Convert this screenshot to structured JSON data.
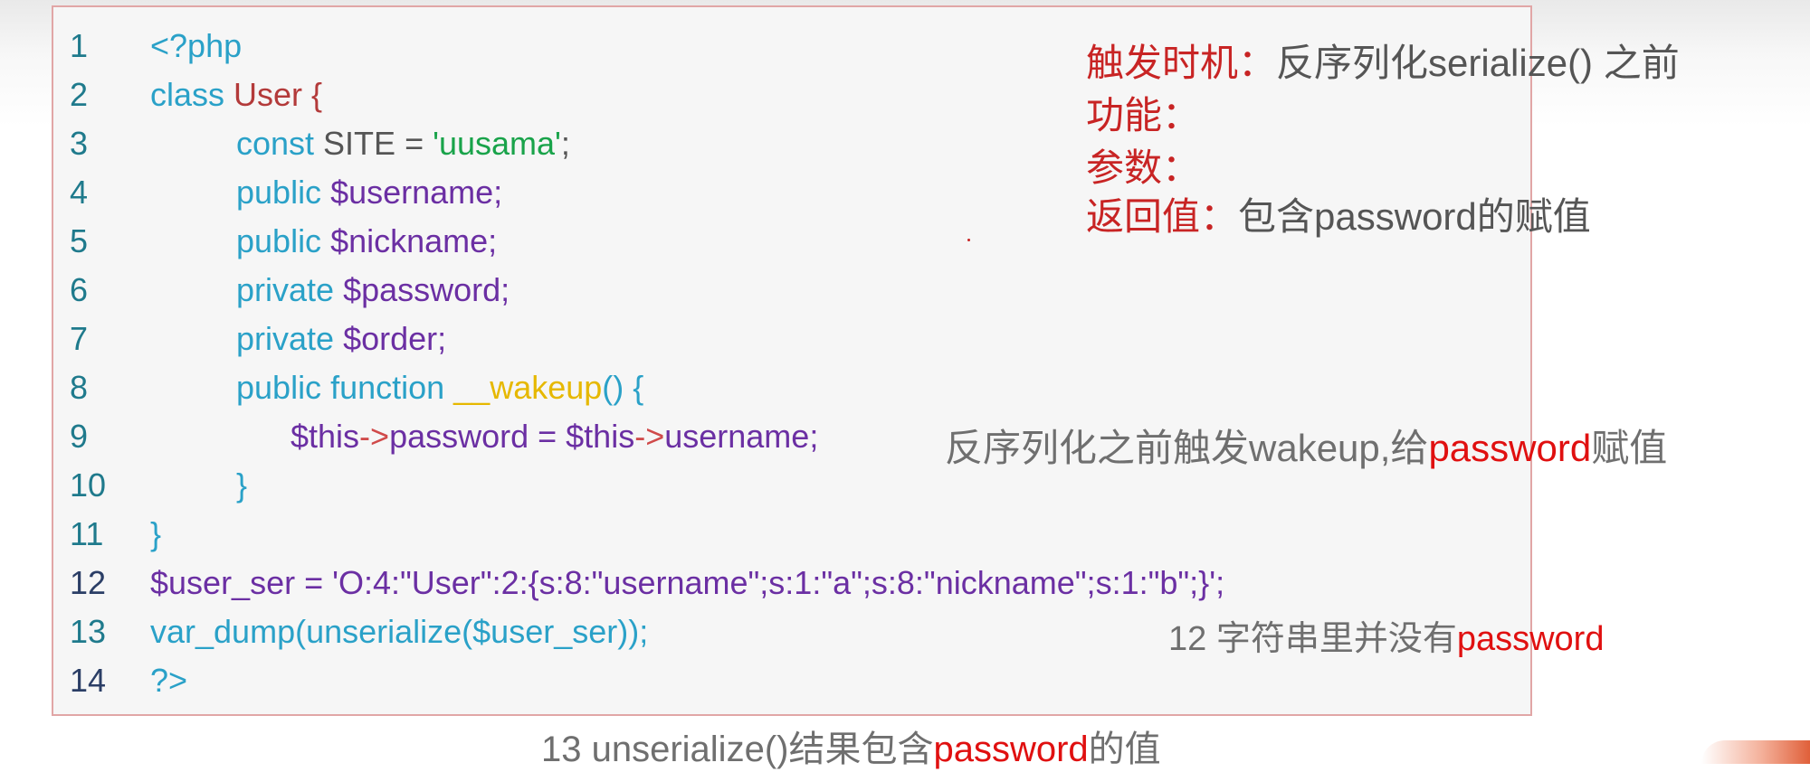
{
  "code": {
    "line_numbers": [
      "1",
      "2",
      "3",
      "4",
      "5",
      "6",
      "7",
      "8",
      "9",
      "10",
      "11",
      "12",
      "13",
      "14"
    ],
    "line1": "<?php",
    "line2_kw": "class ",
    "line2_name": "User {",
    "line3_kw": "const ",
    "line3_name": "SITE = ",
    "line3_str": "'uusama'",
    "line3_end": ";",
    "line4_kw": "public ",
    "line4_var": "$username;",
    "line5_kw": "public ",
    "line5_var": "$nickname;",
    "line6_kw": "private ",
    "line6_var": "$password;",
    "line7_kw": "private ",
    "line7_var": "$order;",
    "line8_kw": "public function ",
    "line8_fn": "__wakeup",
    "line8_end": "() {",
    "line9_a": "$this",
    "line9_arrow1": "->",
    "line9_b": "password = $this",
    "line9_arrow2": "->",
    "line9_c": "username;",
    "line10": "}",
    "line11": "}",
    "line12": "$user_ser = 'O:4:\"User\":2:{s:8:\"username\";s:1:\"a\";s:8:\"nickname\";s:1:\"b\";}';",
    "line13": "var_dump(unserialize($user_ser));",
    "line14": "?>"
  },
  "notes": {
    "trigger_label": "触发时机：",
    "trigger_value": "反序列化serialize() 之前",
    "function_label": "功能：",
    "params_label": "参数：",
    "return_label": "返回值：",
    "return_value": "包含password的赋值",
    "annotation_line9_prefix": "反序列化之前触发wakeup,给",
    "annotation_line9_highlight": "password",
    "annotation_line9_suffix": "赋值",
    "annotation_line12_prefix": "12 字符串里并没有",
    "annotation_line12_highlight": "password",
    "caption_prefix": "13 unserialize()结果包含",
    "caption_highlight": "password",
    "caption_suffix": "的值"
  },
  "colors": {
    "keyword": "#2aa1c8",
    "variable": "#6b2fa3",
    "class_name": "#b33a3a",
    "string": "#19a34a",
    "function_name": "#e6b800",
    "note_label": "#c82424",
    "highlight": "#e01010",
    "panel_border": "#e1a6a6"
  }
}
